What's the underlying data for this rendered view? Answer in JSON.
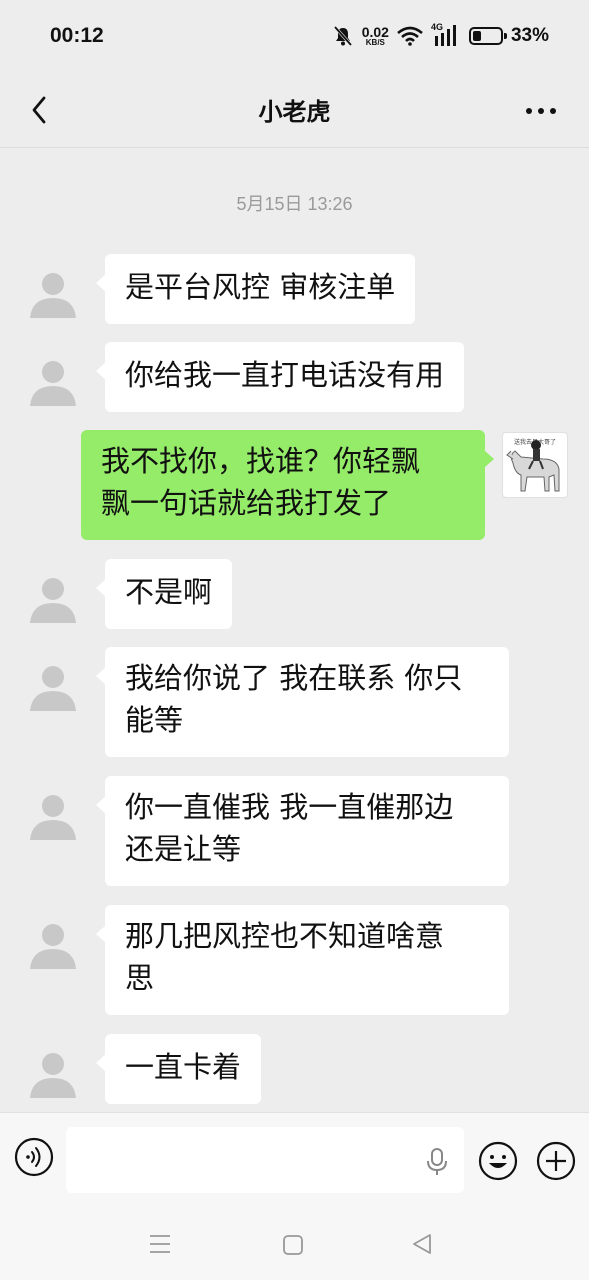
{
  "status_bar": {
    "time": "00:12",
    "net_speed_value": "0.02",
    "net_speed_unit": "KB/S",
    "network_type": "4G",
    "battery_percent_text": "33%",
    "battery_level": 0.33
  },
  "nav": {
    "title": "小老虎"
  },
  "chat": {
    "timestamp": "5月15日 13:26",
    "messages": [
      {
        "side": "left",
        "text": "是平台风控 审核注单"
      },
      {
        "side": "left",
        "text": "你给我一直打电话没有用"
      },
      {
        "side": "right",
        "text_line1": "我不找你，找谁？你轻飘",
        "text_line2": "飘一句话就给我打发了"
      },
      {
        "side": "left",
        "text": "不是啊"
      },
      {
        "side": "left",
        "text_line1": "我给你说了 我在联系 你只",
        "text_line2": "能等"
      },
      {
        "side": "left",
        "text_line1": "你一直催我 我一直催那边",
        "text_line2": "还是让等"
      },
      {
        "side": "left",
        "text_line1": "那几把风控也不知道啥意",
        "text_line2": "思"
      },
      {
        "side": "left",
        "text": "一直卡着"
      }
    ],
    "self_avatar_caption": "送我去见大哥了"
  },
  "icons": {
    "back": "chevron-left-icon",
    "more": "more-horizontal-icon",
    "voice": "voice-icon",
    "mic": "microphone-icon",
    "emoji": "emoji-icon",
    "plus": "plus-icon",
    "default_avatar": "user-silhouette-icon"
  },
  "colors": {
    "background": "#ededed",
    "bubble_self": "#95ec69",
    "bubble_other": "#ffffff",
    "timestamp": "#9a9a9a"
  }
}
